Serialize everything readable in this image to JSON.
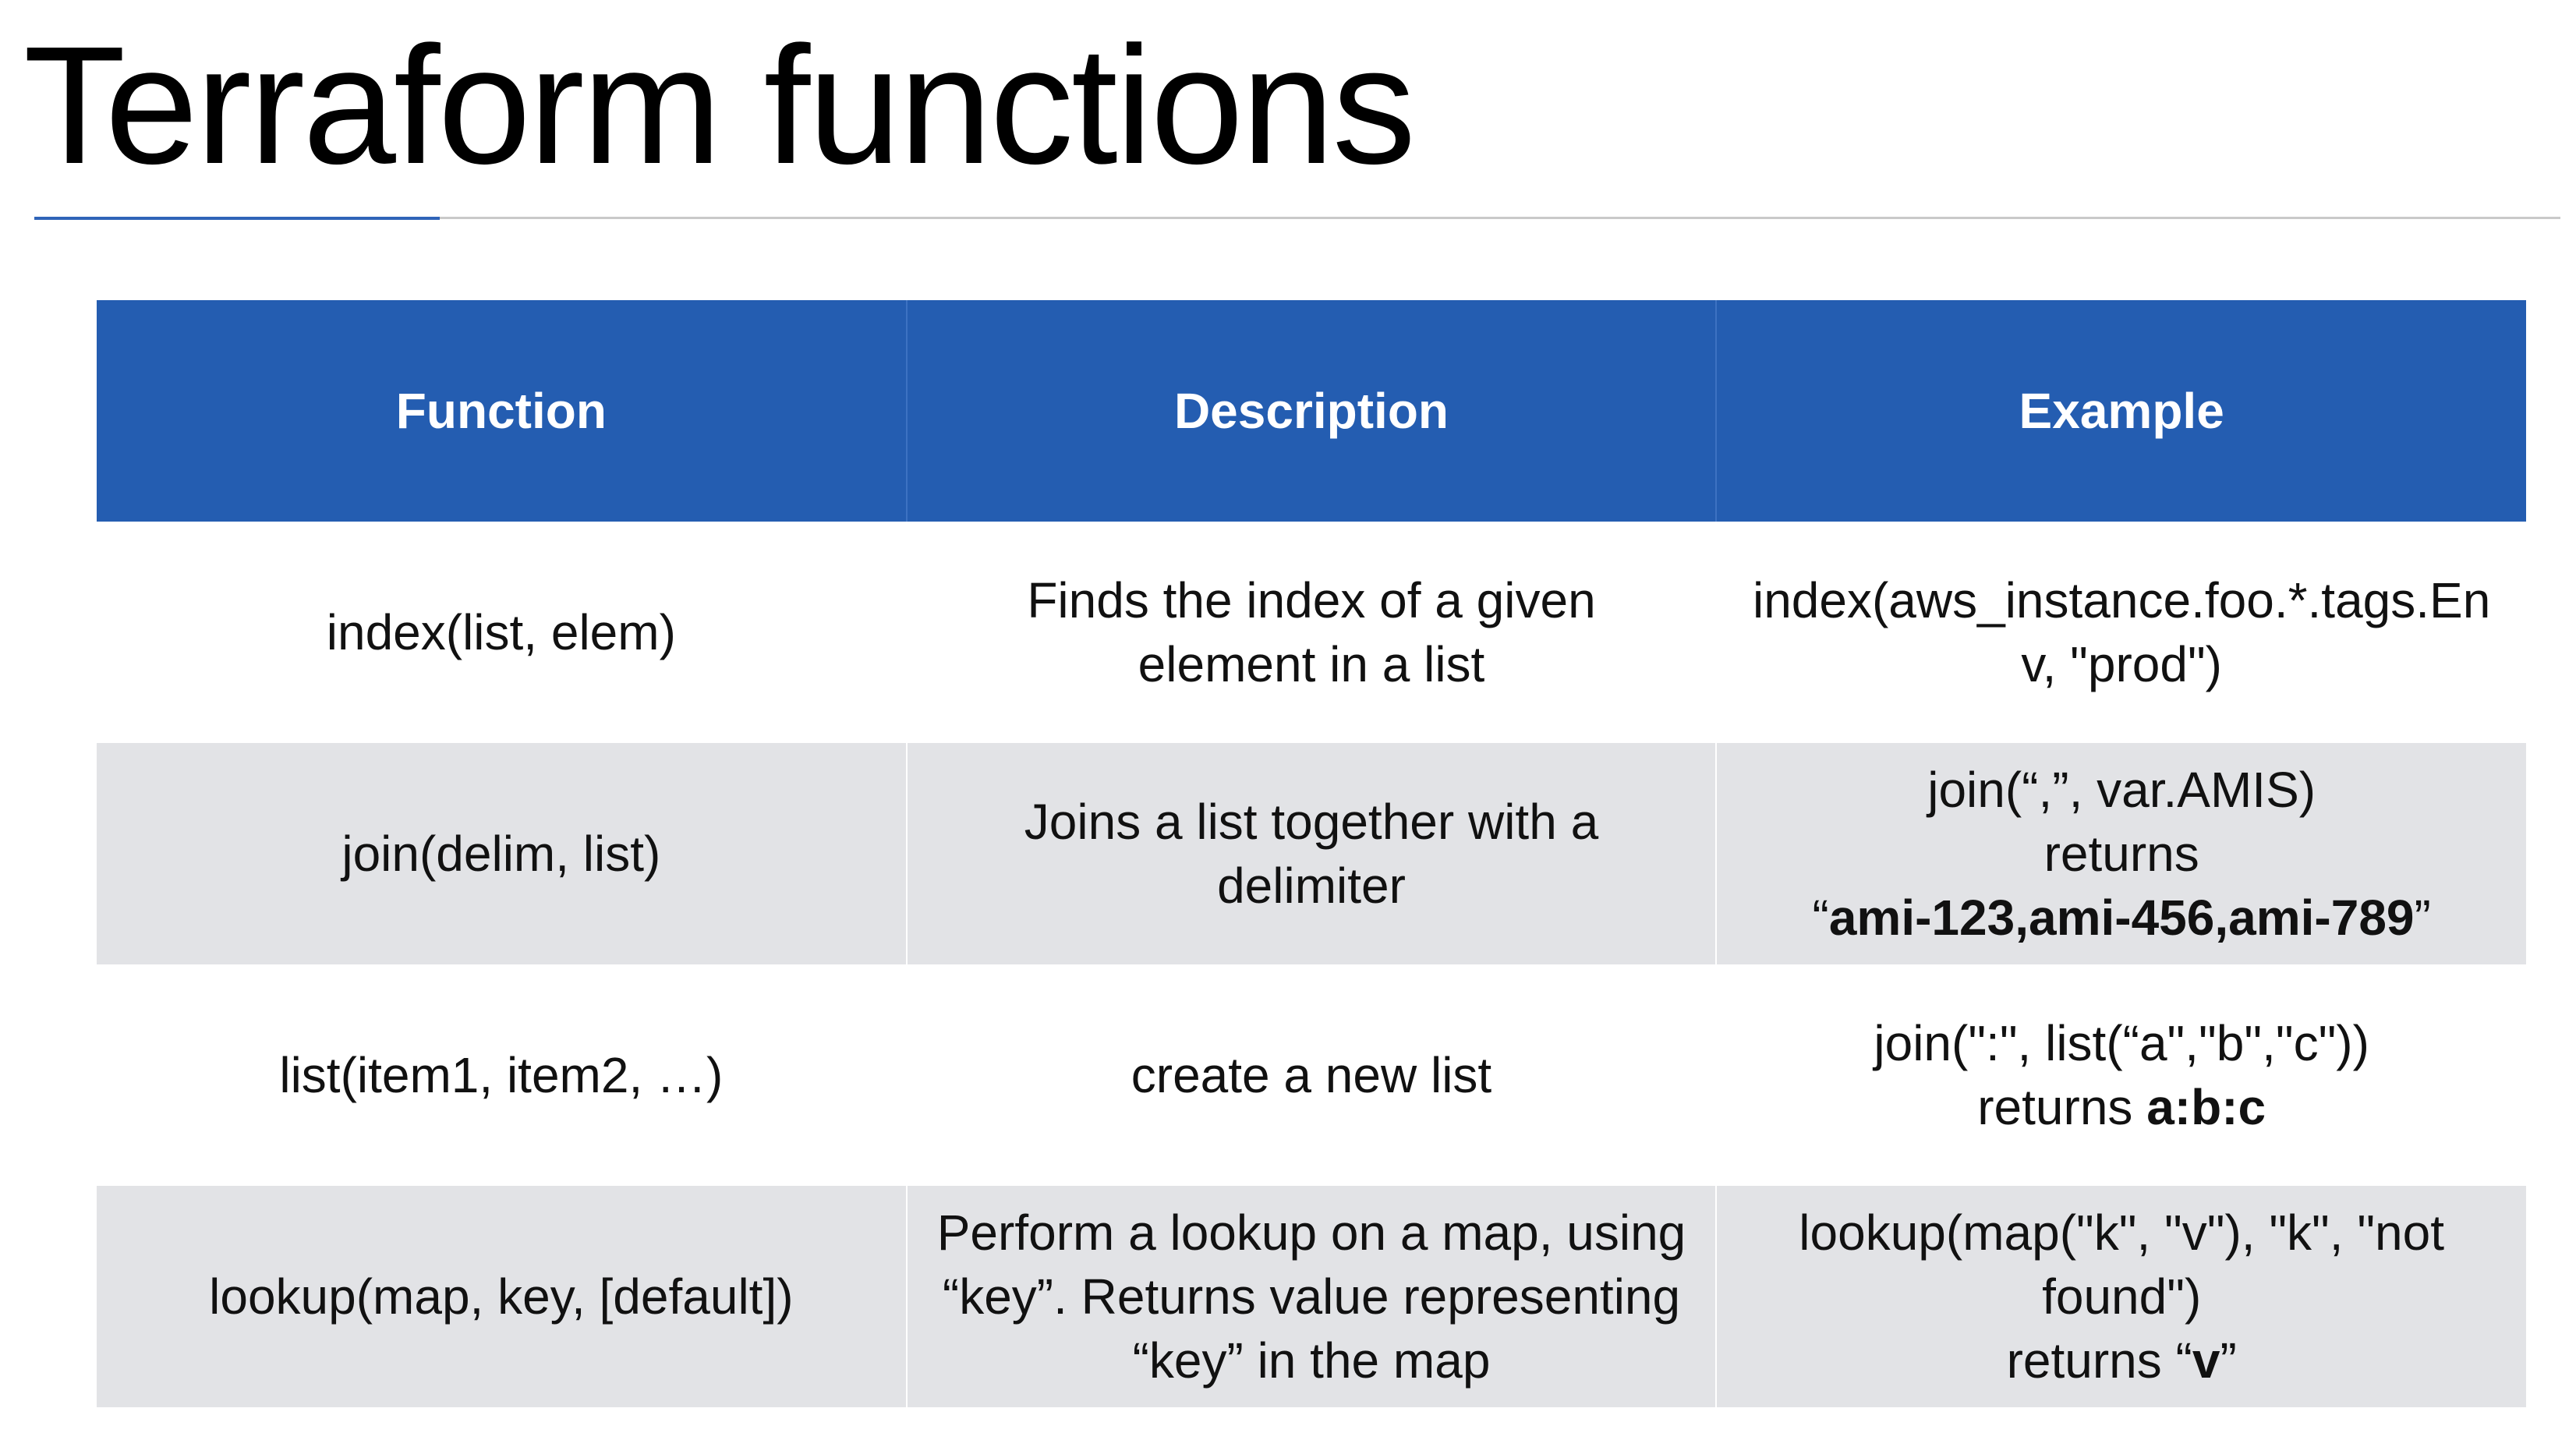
{
  "title": "Terraform functions",
  "colors": {
    "header_bg": "#245db1",
    "header_text": "#ffffff",
    "shaded_row": "#e2e3e6",
    "accent_rule": "#2f64b8"
  },
  "table": {
    "headers": [
      "Function",
      "Description",
      "Example"
    ],
    "rows": [
      {
        "function": "index(list, elem)",
        "description": [
          "Finds the index of a given",
          "element in a list"
        ],
        "example": {
          "code": [
            "index(aws_instance.foo.*.tags.En",
            "v, \"prod\")"
          ]
        }
      },
      {
        "function": "join(delim, list)",
        "description": [
          "Joins a list together with a",
          "delimiter"
        ],
        "example": {
          "code": [
            "join(“,”, var.AMIS)"
          ],
          "returns_label": "returns",
          "open_quote": "“",
          "result": "ami-123,ami-456,ami-789",
          "close_quote": "”"
        }
      },
      {
        "function": "list(item1, item2, …)",
        "description": [
          "create a new list"
        ],
        "example": {
          "code": [
            "join(\":\", list(“a\",\"b\",\"c\"))"
          ],
          "returns_label": "returns",
          "result": "a:b:c"
        }
      },
      {
        "function": "lookup(map, key, [default])",
        "description": [
          "Perform a lookup on a map, using",
          "“key”. Returns value representing",
          "“key” in the map"
        ],
        "example": {
          "code": [
            "lookup(map(\"k\", \"v\"), \"k\", \"not",
            "found\")"
          ],
          "returns_label": "returns",
          "open_quote": "“",
          "result": "v",
          "close_quote": "”"
        }
      }
    ]
  }
}
